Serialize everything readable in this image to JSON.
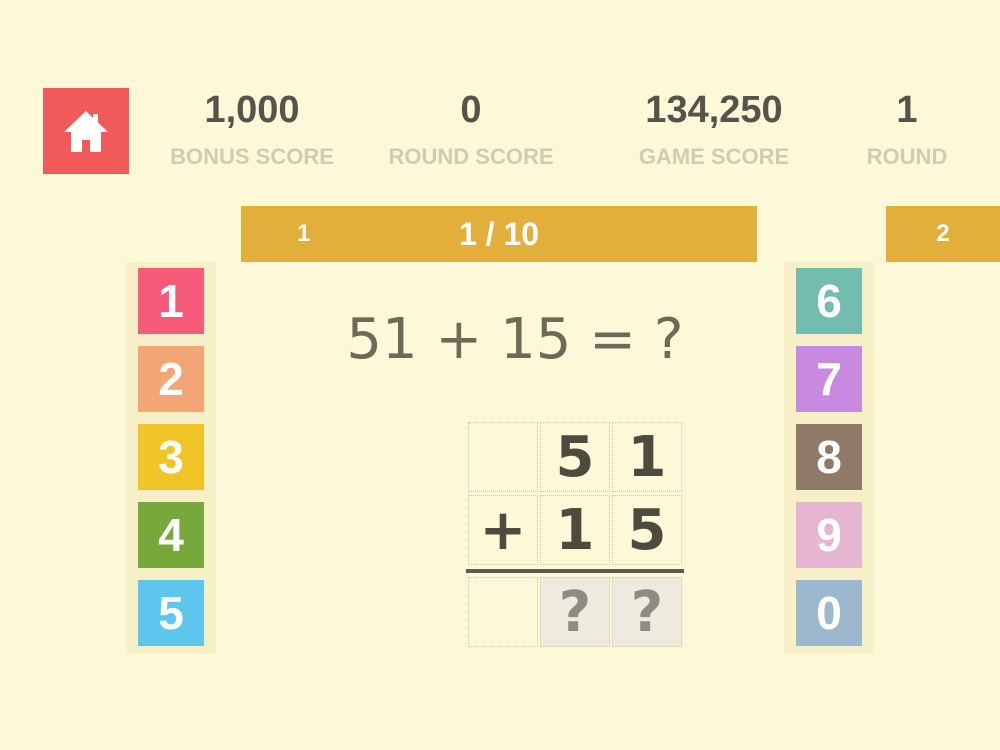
{
  "header": {
    "home_icon": "home-icon",
    "stats": [
      {
        "value": "1,000",
        "label": "BONUS SCORE"
      },
      {
        "value": "0",
        "label": "ROUND SCORE"
      },
      {
        "value": "134,250",
        "label": "GAME SCORE"
      },
      {
        "value": "1",
        "label": "ROUND"
      }
    ]
  },
  "progress": {
    "current_marker": "1",
    "counter": "1 / 10",
    "next_marker": "2"
  },
  "keypad": {
    "left": [
      {
        "digit": "1",
        "color": "#f65c7a"
      },
      {
        "digit": "2",
        "color": "#f4a574"
      },
      {
        "digit": "3",
        "color": "#f1c427"
      },
      {
        "digit": "4",
        "color": "#76a93a"
      },
      {
        "digit": "5",
        "color": "#5cc6ec"
      }
    ],
    "right": [
      {
        "digit": "6",
        "color": "#72bdaf"
      },
      {
        "digit": "7",
        "color": "#c88ae0"
      },
      {
        "digit": "8",
        "color": "#8e7a67"
      },
      {
        "digit": "9",
        "color": "#e6b5d2"
      },
      {
        "digit": "0",
        "color": "#9bb8cc"
      }
    ]
  },
  "problem": {
    "equation": "51 + 15 = ?",
    "grid": [
      [
        "",
        "5",
        "1"
      ],
      [
        "+",
        "1",
        "5"
      ],
      [
        "",
        "?",
        "?"
      ]
    ]
  }
}
